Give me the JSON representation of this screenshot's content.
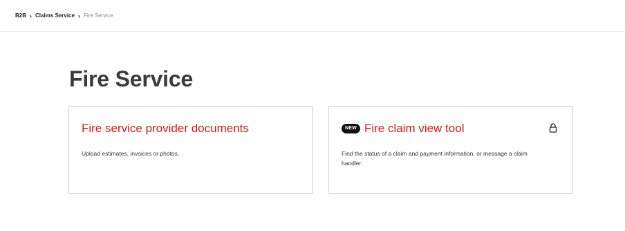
{
  "breadcrumb": {
    "items": [
      {
        "label": "B2B"
      },
      {
        "label": "Claims Service"
      }
    ],
    "current": "Fire Service",
    "separator_icon": "chevron-right-icon"
  },
  "page": {
    "title": "Fire Service"
  },
  "cards": [
    {
      "title": "Fire service provider documents",
      "description": "Upload estimates, invoices or photos.",
      "badge": "",
      "locked": false
    },
    {
      "title": "Fire claim view tool",
      "description": "Find the status of a claim and payment information, or message a claim handler.",
      "badge": "NEW",
      "locked": true,
      "lock_icon": "lock-icon"
    }
  ],
  "colors": {
    "link_red": "#d11a1a",
    "badge_bg": "#111111",
    "title_text": "#3b3b3b",
    "card_border": "#cfcfcf"
  }
}
